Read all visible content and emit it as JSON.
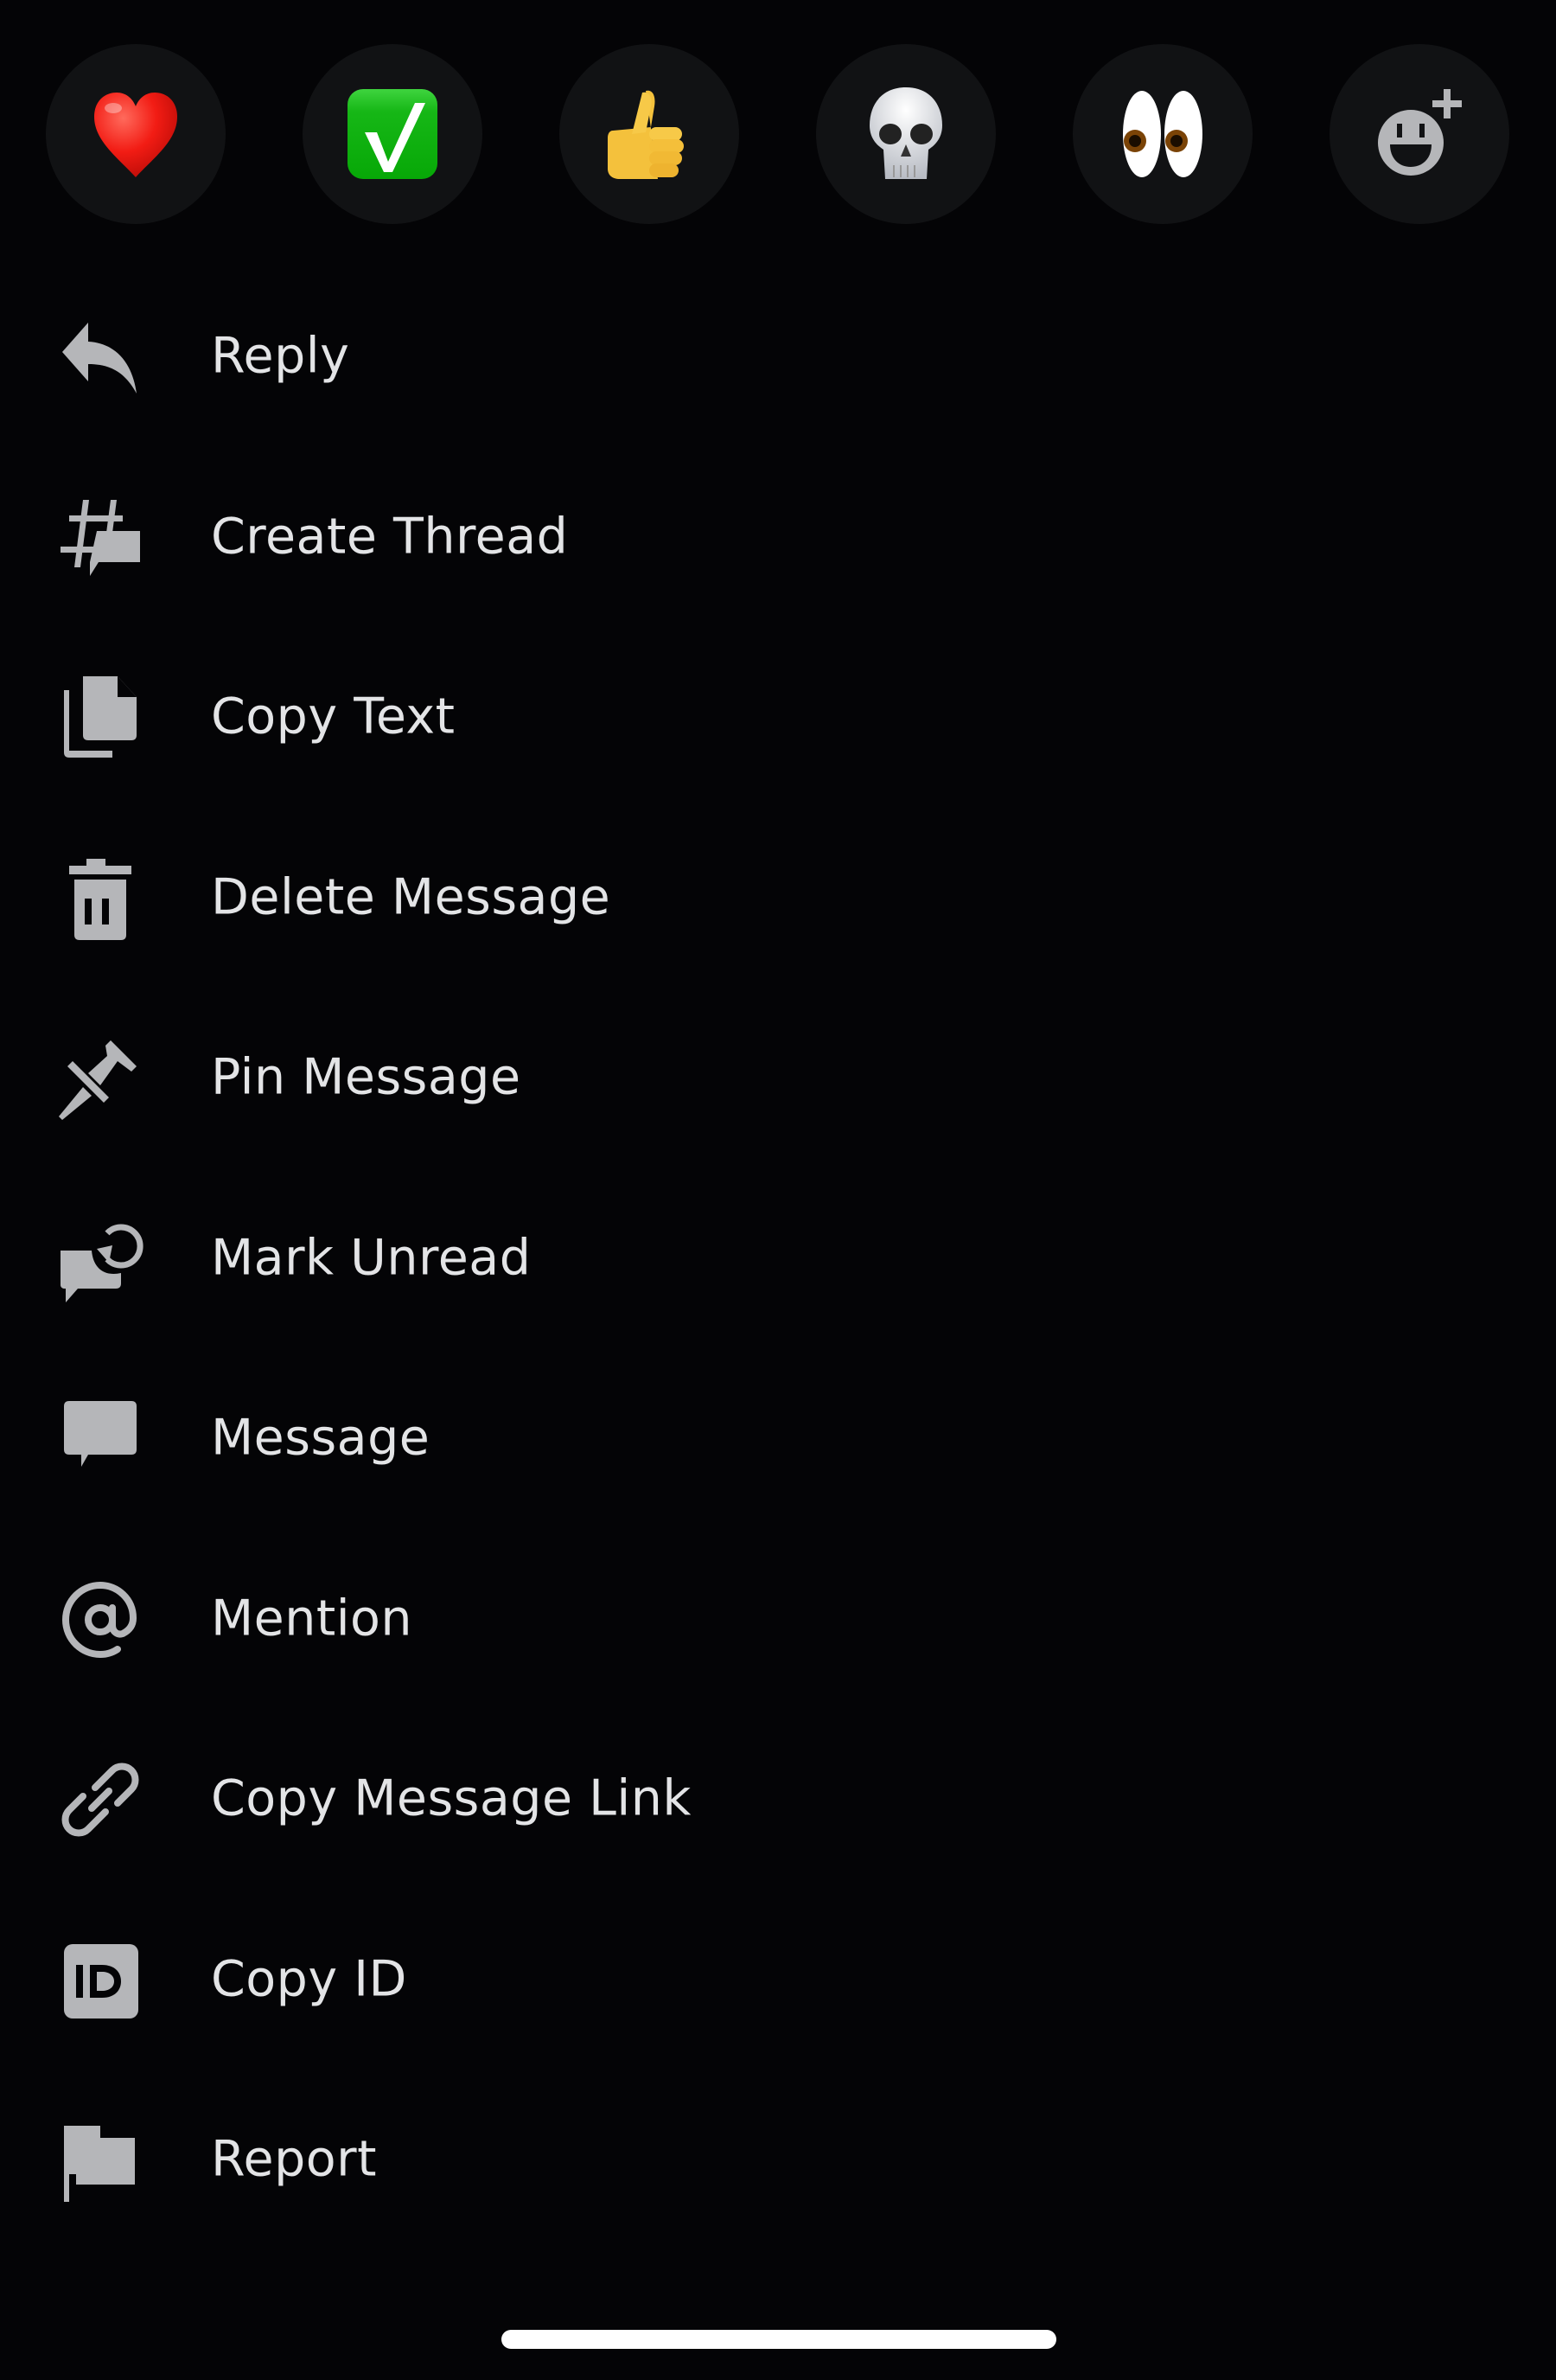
{
  "reactions": [
    {
      "emoji": "❤️",
      "name": "red-heart"
    },
    {
      "emoji": "✅",
      "name": "check-mark-button"
    },
    {
      "emoji": "👍",
      "name": "thumbs-up"
    },
    {
      "emoji": "💀",
      "name": "skull"
    },
    {
      "emoji": "👀",
      "name": "eyes"
    },
    {
      "emoji": "",
      "name": "add-reaction"
    }
  ],
  "menu": {
    "items": [
      {
        "label": "Reply",
        "icon": "reply-icon"
      },
      {
        "label": "Create Thread",
        "icon": "thread-icon"
      },
      {
        "label": "Copy Text",
        "icon": "copy-icon"
      },
      {
        "label": "Delete Message",
        "icon": "trash-icon"
      },
      {
        "label": "Pin Message",
        "icon": "pin-icon"
      },
      {
        "label": "Mark Unread",
        "icon": "mark-unread-icon"
      },
      {
        "label": "Message",
        "icon": "chat-bubble-icon"
      },
      {
        "label": "Mention",
        "icon": "at-sign-icon"
      },
      {
        "label": "Copy Message Link",
        "icon": "link-icon"
      },
      {
        "label": "Copy ID",
        "icon": "id-badge-icon"
      },
      {
        "label": "Report",
        "icon": "flag-icon"
      }
    ]
  },
  "colors": {
    "background": "#040406",
    "reaction_bg": "#111214",
    "icon": "#b5b6b9",
    "text": "#e3e4e6"
  }
}
